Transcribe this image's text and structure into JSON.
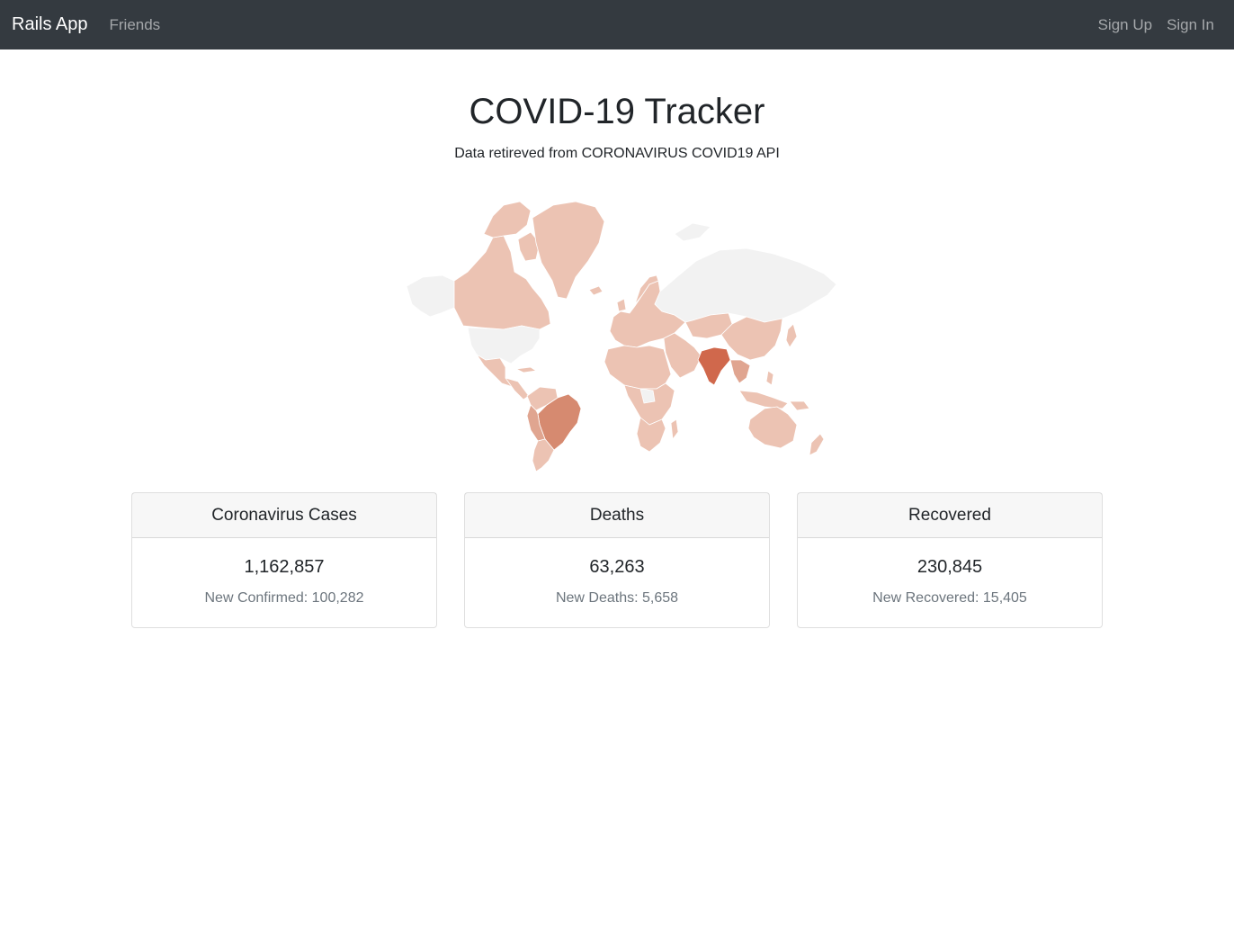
{
  "navbar": {
    "brand": "Rails App",
    "links": [
      {
        "label": "Friends"
      }
    ],
    "right_links": [
      {
        "label": "Sign Up"
      },
      {
        "label": "Sign In"
      }
    ]
  },
  "page": {
    "title": "COVID-19 Tracker",
    "subtitle": "Data retireved from CORONAVIRUS COVID19 API"
  },
  "map": {
    "colors": {
      "none": "#f2f2f2",
      "low": "#ecc3b3",
      "medium": "#e0a590",
      "high": "#d68a70",
      "highest": "#d0684c",
      "border": "#ffffff"
    }
  },
  "cards": [
    {
      "header": "Coronavirus Cases",
      "value": "1,162,857",
      "sub": "New Confirmed: 100,282"
    },
    {
      "header": "Deaths",
      "value": "63,263",
      "sub": "New Deaths: 5,658"
    },
    {
      "header": "Recovered",
      "value": "230,845",
      "sub": "New Recovered: 15,405"
    }
  ]
}
